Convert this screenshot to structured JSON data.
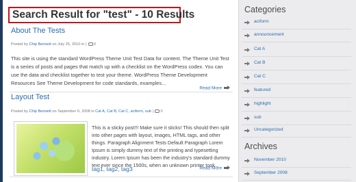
{
  "search": {
    "title": "Search Result for \"test\" - 10 Results"
  },
  "posts": [
    {
      "title": "About The Tests",
      "meta_prefix": "Posted by ",
      "author": "Chip Bennett",
      "meta_date": " on July 25, 2010 in | ",
      "comments": "0",
      "body": "This site is using the standard WordPress Theme Unit Test Data for content. The Theme Unit Test is a series of posts and pages that match up with a checklist on the WordPress codex. You can use the data and checklist together to test your theme. WordPress Theme Development Resources See Theme Development for code standards, examples...",
      "read_more": "Read More"
    },
    {
      "title": "Layout Test",
      "meta_prefix": "Posted by ",
      "author": "Chip Bennett",
      "meta_date": " on September 6, 2008 in ",
      "categories": "Cat A, Cat B, Cat C, aciform, sub",
      "meta_sep": " | ",
      "comments": "0"
    },
    {
      "body": "This is a sticky post!!! Make sure it sticks! This should then split into other pages with layout, images, HTML tags, and other things. Paragraph Alignment Tests Default Paragraph Lorem Ipsum is simply dummy text of the printing and typesetting industry. Lorem Ipsum has been the industry's standard dummy text ever since the 1500s, when an unknown printer took...",
      "tags": "tag1, tag2, tag3",
      "read_more": "Read More"
    }
  ],
  "sidebar": {
    "categories_heading": "Categories",
    "categories": [
      {
        "label": "aciform"
      },
      {
        "label": "announcement"
      },
      {
        "label": "Cat A"
      },
      {
        "label": "Cat B"
      },
      {
        "label": "Cat C"
      },
      {
        "label": "featured"
      },
      {
        "label": "highlight"
      },
      {
        "label": "sub"
      },
      {
        "label": "Uncategorized"
      }
    ],
    "archives_heading": "Archives",
    "archives": [
      {
        "label": "November 2010"
      },
      {
        "label": "September 2008"
      }
    ]
  },
  "colors": {
    "accent_link": "#2a6cb0",
    "highlight_border": "#c0141b",
    "sidebar_bg": "#ececee",
    "page_bg": "#1f3a5e"
  },
  "icons": [
    "arrow-right-icon",
    "comment-icon",
    "bullet-arrow-icon"
  ]
}
